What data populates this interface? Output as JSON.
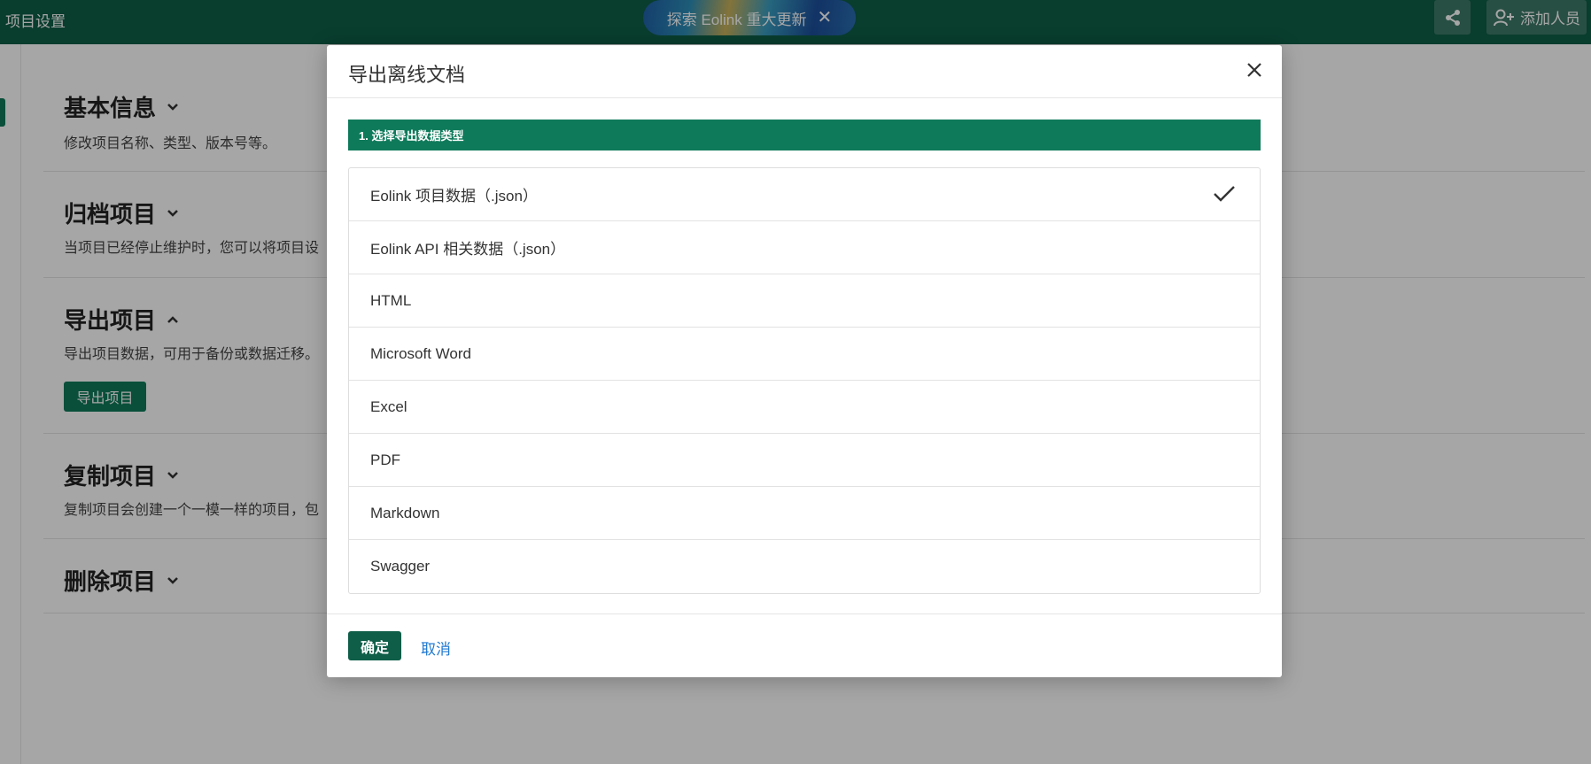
{
  "header": {
    "page_title": "项目设置",
    "banner_text": "探索 Eolink 重大更新",
    "banner_close": "✕",
    "add_member_label": "添加人员"
  },
  "sections": {
    "basic": {
      "title": "基本信息",
      "desc": "修改项目名称、类型、版本号等。"
    },
    "archive": {
      "title": "归档项目",
      "desc": "当项目已经停止维护时，您可以将项目设"
    },
    "export": {
      "title": "导出项目",
      "desc": "导出项目数据，可用于备份或数据迁移。",
      "button_label": "导出项目"
    },
    "copy": {
      "title": "复制项目",
      "desc": "复制项目会创建一个一模一样的项目，包"
    },
    "delete": {
      "title": "删除项目"
    }
  },
  "modal": {
    "title": "导出离线文档",
    "step_label": "1. 选择导出数据类型",
    "options": [
      {
        "label": "Eolink 项目数据（.json）",
        "selected": true
      },
      {
        "label": "Eolink API 相关数据（.json）",
        "selected": false
      },
      {
        "label": "HTML",
        "selected": false
      },
      {
        "label": "Microsoft Word",
        "selected": false
      },
      {
        "label": "Excel",
        "selected": false
      },
      {
        "label": "PDF",
        "selected": false
      },
      {
        "label": "Markdown",
        "selected": false
      },
      {
        "label": "Swagger",
        "selected": false
      }
    ],
    "confirm_label": "确定",
    "cancel_label": "取消"
  },
  "colors": {
    "topbar": "#0f5e48",
    "accent": "#0f7a5a",
    "link": "#1f78d1"
  },
  "icons": [
    "share-icon",
    "add-user-icon",
    "chevron-down-icon",
    "chevron-up-icon",
    "close-icon",
    "check-icon"
  ]
}
